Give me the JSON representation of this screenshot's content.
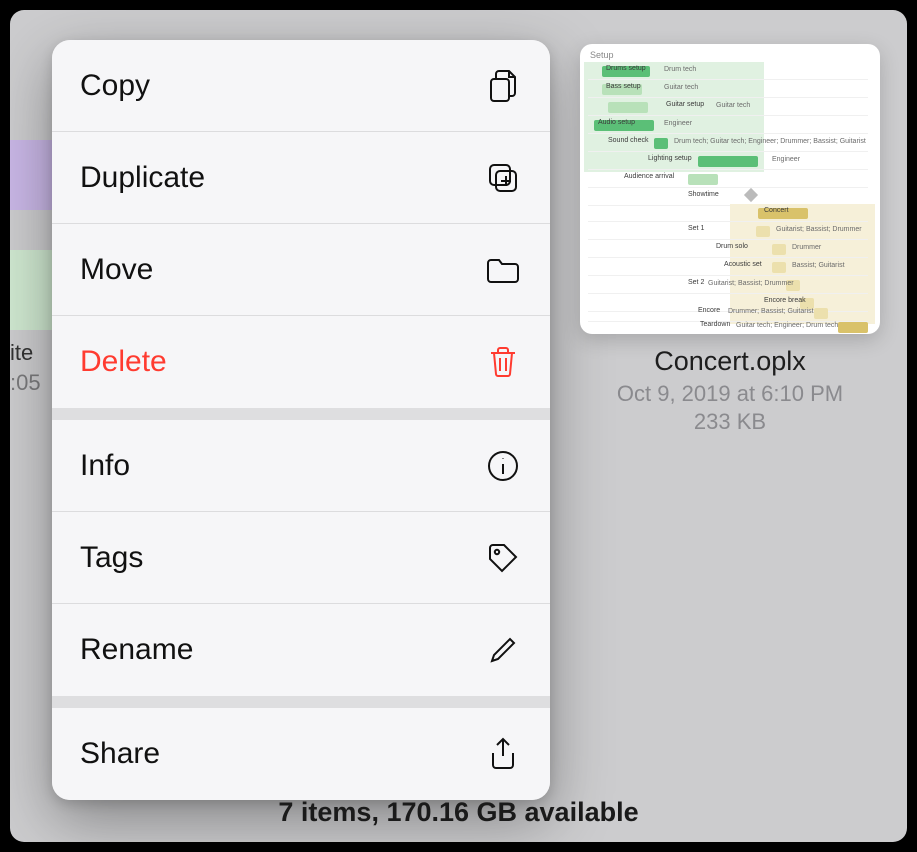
{
  "background": {
    "partial_label_1": "ite",
    "partial_label_2": ":05"
  },
  "context_menu": {
    "groups": [
      [
        {
          "label": "Copy",
          "icon": "copy-icon",
          "destructive": false
        },
        {
          "label": "Duplicate",
          "icon": "duplicate-icon",
          "destructive": false
        },
        {
          "label": "Move",
          "icon": "folder-icon",
          "destructive": false
        },
        {
          "label": "Delete",
          "icon": "trash-icon",
          "destructive": true
        }
      ],
      [
        {
          "label": "Info",
          "icon": "info-icon",
          "destructive": false
        },
        {
          "label": "Tags",
          "icon": "tag-icon",
          "destructive": false
        },
        {
          "label": "Rename",
          "icon": "pencil-icon",
          "destructive": false
        }
      ],
      [
        {
          "label": "Share",
          "icon": "share-icon",
          "destructive": false
        }
      ]
    ]
  },
  "file": {
    "name": "Concert.oplx",
    "date": "Oct 9, 2019 at 6:10 PM",
    "size": "233 KB",
    "thumb": {
      "heading": "Setup",
      "rows": [
        {
          "bar_label": "Drums setup",
          "text": "Drum tech"
        },
        {
          "bar_label": "Bass setup",
          "text": "Guitar tech"
        },
        {
          "bar_label": "Guitar setup",
          "text": "Guitar tech"
        },
        {
          "bar_label": "Audio setup",
          "text": "Engineer"
        },
        {
          "bar_label": "Sound check",
          "text": "Drum tech; Guitar tech; Engineer; Drummer; Bassist; Guitarist"
        },
        {
          "bar_label": "Lighting setup",
          "text": "Engineer"
        },
        {
          "bar_label": "Audience arrival",
          "text": ""
        },
        {
          "bar_label": "Showtime",
          "text": ""
        },
        {
          "bar_label": "Concert",
          "text": ""
        },
        {
          "bar_label": "Set 1",
          "text": "Guitarist; Bassist; Drummer"
        },
        {
          "bar_label": "Drum solo",
          "text": "Drummer"
        },
        {
          "bar_label": "Acoustic set",
          "text": "Bassist; Guitarist"
        },
        {
          "bar_label": "Set 2",
          "text": "Guitarist; Bassist; Drummer"
        },
        {
          "bar_label": "Encore break",
          "text": ""
        },
        {
          "bar_label": "Encore",
          "text": "Drummer; Bassist; Guitarist"
        },
        {
          "bar_label": "Teardown",
          "text": "Guitar tech; Engineer; Drum tech"
        }
      ]
    }
  },
  "status": "7 items, 170.16 GB available"
}
